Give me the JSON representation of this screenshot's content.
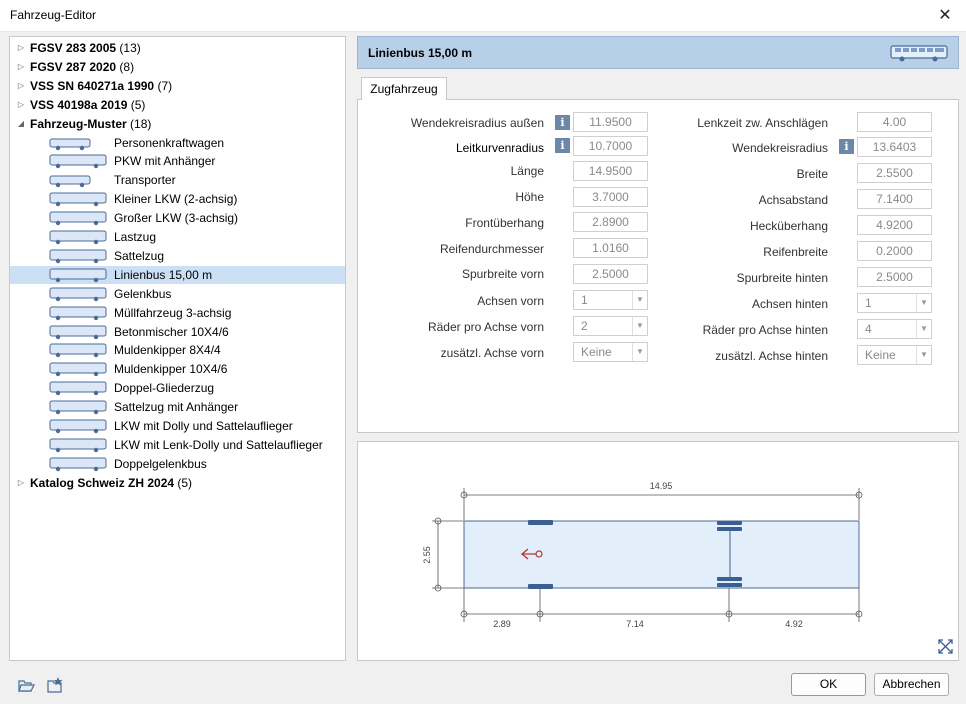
{
  "window": {
    "title": "Fahrzeug-Editor"
  },
  "tree": {
    "groups_top": [
      {
        "name": "FGSV 283 2005",
        "count": "(13)"
      },
      {
        "name": "FGSV 287 2020",
        "count": "(8)"
      },
      {
        "name": "VSS SN 640271a 1990",
        "count": "(7)"
      },
      {
        "name": "VSS 40198a 2019",
        "count": "(5)"
      }
    ],
    "open_group": {
      "name": "Fahrzeug-Muster",
      "count": "(18)"
    },
    "items": [
      {
        "label": "Personenkraftwagen",
        "icon": "car-icon"
      },
      {
        "label": "PKW mit Anhänger",
        "icon": "car-trailer-icon"
      },
      {
        "label": "Transporter",
        "icon": "van-icon"
      },
      {
        "label": "Kleiner LKW (2-achsig)",
        "icon": "small-truck-icon"
      },
      {
        "label": "Großer LKW (3-achsig)",
        "icon": "large-truck-icon"
      },
      {
        "label": "Lastzug",
        "icon": "truck-trailer-icon"
      },
      {
        "label": "Sattelzug",
        "icon": "semi-truck-icon"
      },
      {
        "label": "Linienbus 15,00 m",
        "icon": "bus-icon"
      },
      {
        "label": "Gelenkbus",
        "icon": "articulated-bus-icon"
      },
      {
        "label": "Müllfahrzeug 3-achsig",
        "icon": "garbage-truck-icon"
      },
      {
        "label": "Betonmischer 10X4/6",
        "icon": "concrete-mixer-icon"
      },
      {
        "label": "Muldenkipper 8X4/4",
        "icon": "dump-truck-icon"
      },
      {
        "label": "Muldenkipper 10X4/6",
        "icon": "dump-truck-icon"
      },
      {
        "label": "Doppel-Gliederzug",
        "icon": "double-trailer-icon"
      },
      {
        "label": "Sattelzug  mit Anhänger",
        "icon": "semi-trailer-icon"
      },
      {
        "label": "LKW mit Dolly und Sattelauflieger",
        "icon": "dolly-truck-icon"
      },
      {
        "label": "LKW mit Lenk-Dolly und Sattelauflieger",
        "icon": "steer-dolly-truck-icon"
      },
      {
        "label": "Doppelgelenkbus",
        "icon": "double-articulated-bus-icon"
      }
    ],
    "selected_index": 7,
    "groups_bottom": [
      {
        "name": "Katalog Schweiz ZH 2024",
        "count": "(5)"
      }
    ]
  },
  "header": {
    "title": "Linienbus 15,00 m",
    "icon": "bus-icon"
  },
  "tab": {
    "label": "Zugfahrzeug"
  },
  "fields_left": {
    "wendekreis_aussen": {
      "label": "Wendekreisradius außen",
      "value": "11.9500"
    },
    "leitkurvenradius": {
      "label": "Leitkurvenradius",
      "value": "10.7000"
    },
    "laenge": {
      "label": "Länge",
      "value": "14.9500"
    },
    "hoehe": {
      "label": "Höhe",
      "value": "3.7000"
    },
    "frontueberhang": {
      "label": "Frontüberhang",
      "value": "2.8900"
    },
    "reifendurchmesser": {
      "label": "Reifendurchmesser",
      "value": "1.0160"
    },
    "spurbreite_vorn": {
      "label": "Spurbreite vorn",
      "value": "2.5000"
    },
    "achsen_vorn": {
      "label": "Achsen vorn",
      "value": "1"
    },
    "raeder_vorn": {
      "label": "Räder pro Achse vorn",
      "value": "2"
    },
    "zusatz_vorn": {
      "label": "zusätzl. Achse vorn",
      "value": "Keine"
    }
  },
  "fields_right": {
    "lenkzeit": {
      "label": "Lenkzeit zw. Anschlägen",
      "value": "4.00"
    },
    "wendekreis": {
      "label": "Wendekreisradius",
      "value": "13.6403"
    },
    "breite": {
      "label": "Breite",
      "value": "2.5500"
    },
    "achsabstand": {
      "label": "Achsabstand",
      "value": "7.1400"
    },
    "heckueberhang": {
      "label": "Hecküberhang",
      "value": "4.9200"
    },
    "reifenbreite": {
      "label": "Reifenbreite",
      "value": "0.2000"
    },
    "spurbreite_hinten": {
      "label": "Spurbreite hinten",
      "value": "2.5000"
    },
    "achsen_hinten": {
      "label": "Achsen hinten",
      "value": "1"
    },
    "raeder_hinten": {
      "label": "Räder pro Achse hinten",
      "value": "4"
    },
    "zusatz_hinten": {
      "label": "zusätzl. Achse hinten",
      "value": "Keine"
    }
  },
  "diagram": {
    "length_label": "14.95",
    "width_label": "2.55",
    "front_label": "2.89",
    "wheelbase_label": "7.14",
    "rear_label": "4.92",
    "fit_icon": "fit-view-icon"
  },
  "footer": {
    "open_icon": "folder-open-icon",
    "favorite_icon": "favorite-add-icon",
    "ok_label": "OK",
    "cancel_label": "Abbrechen"
  },
  "colors": {
    "selection": "#cce0f5",
    "header": "#b8cfe8",
    "vehicle": "#4a6b99",
    "vehicle_fill": "#e3eefb"
  }
}
